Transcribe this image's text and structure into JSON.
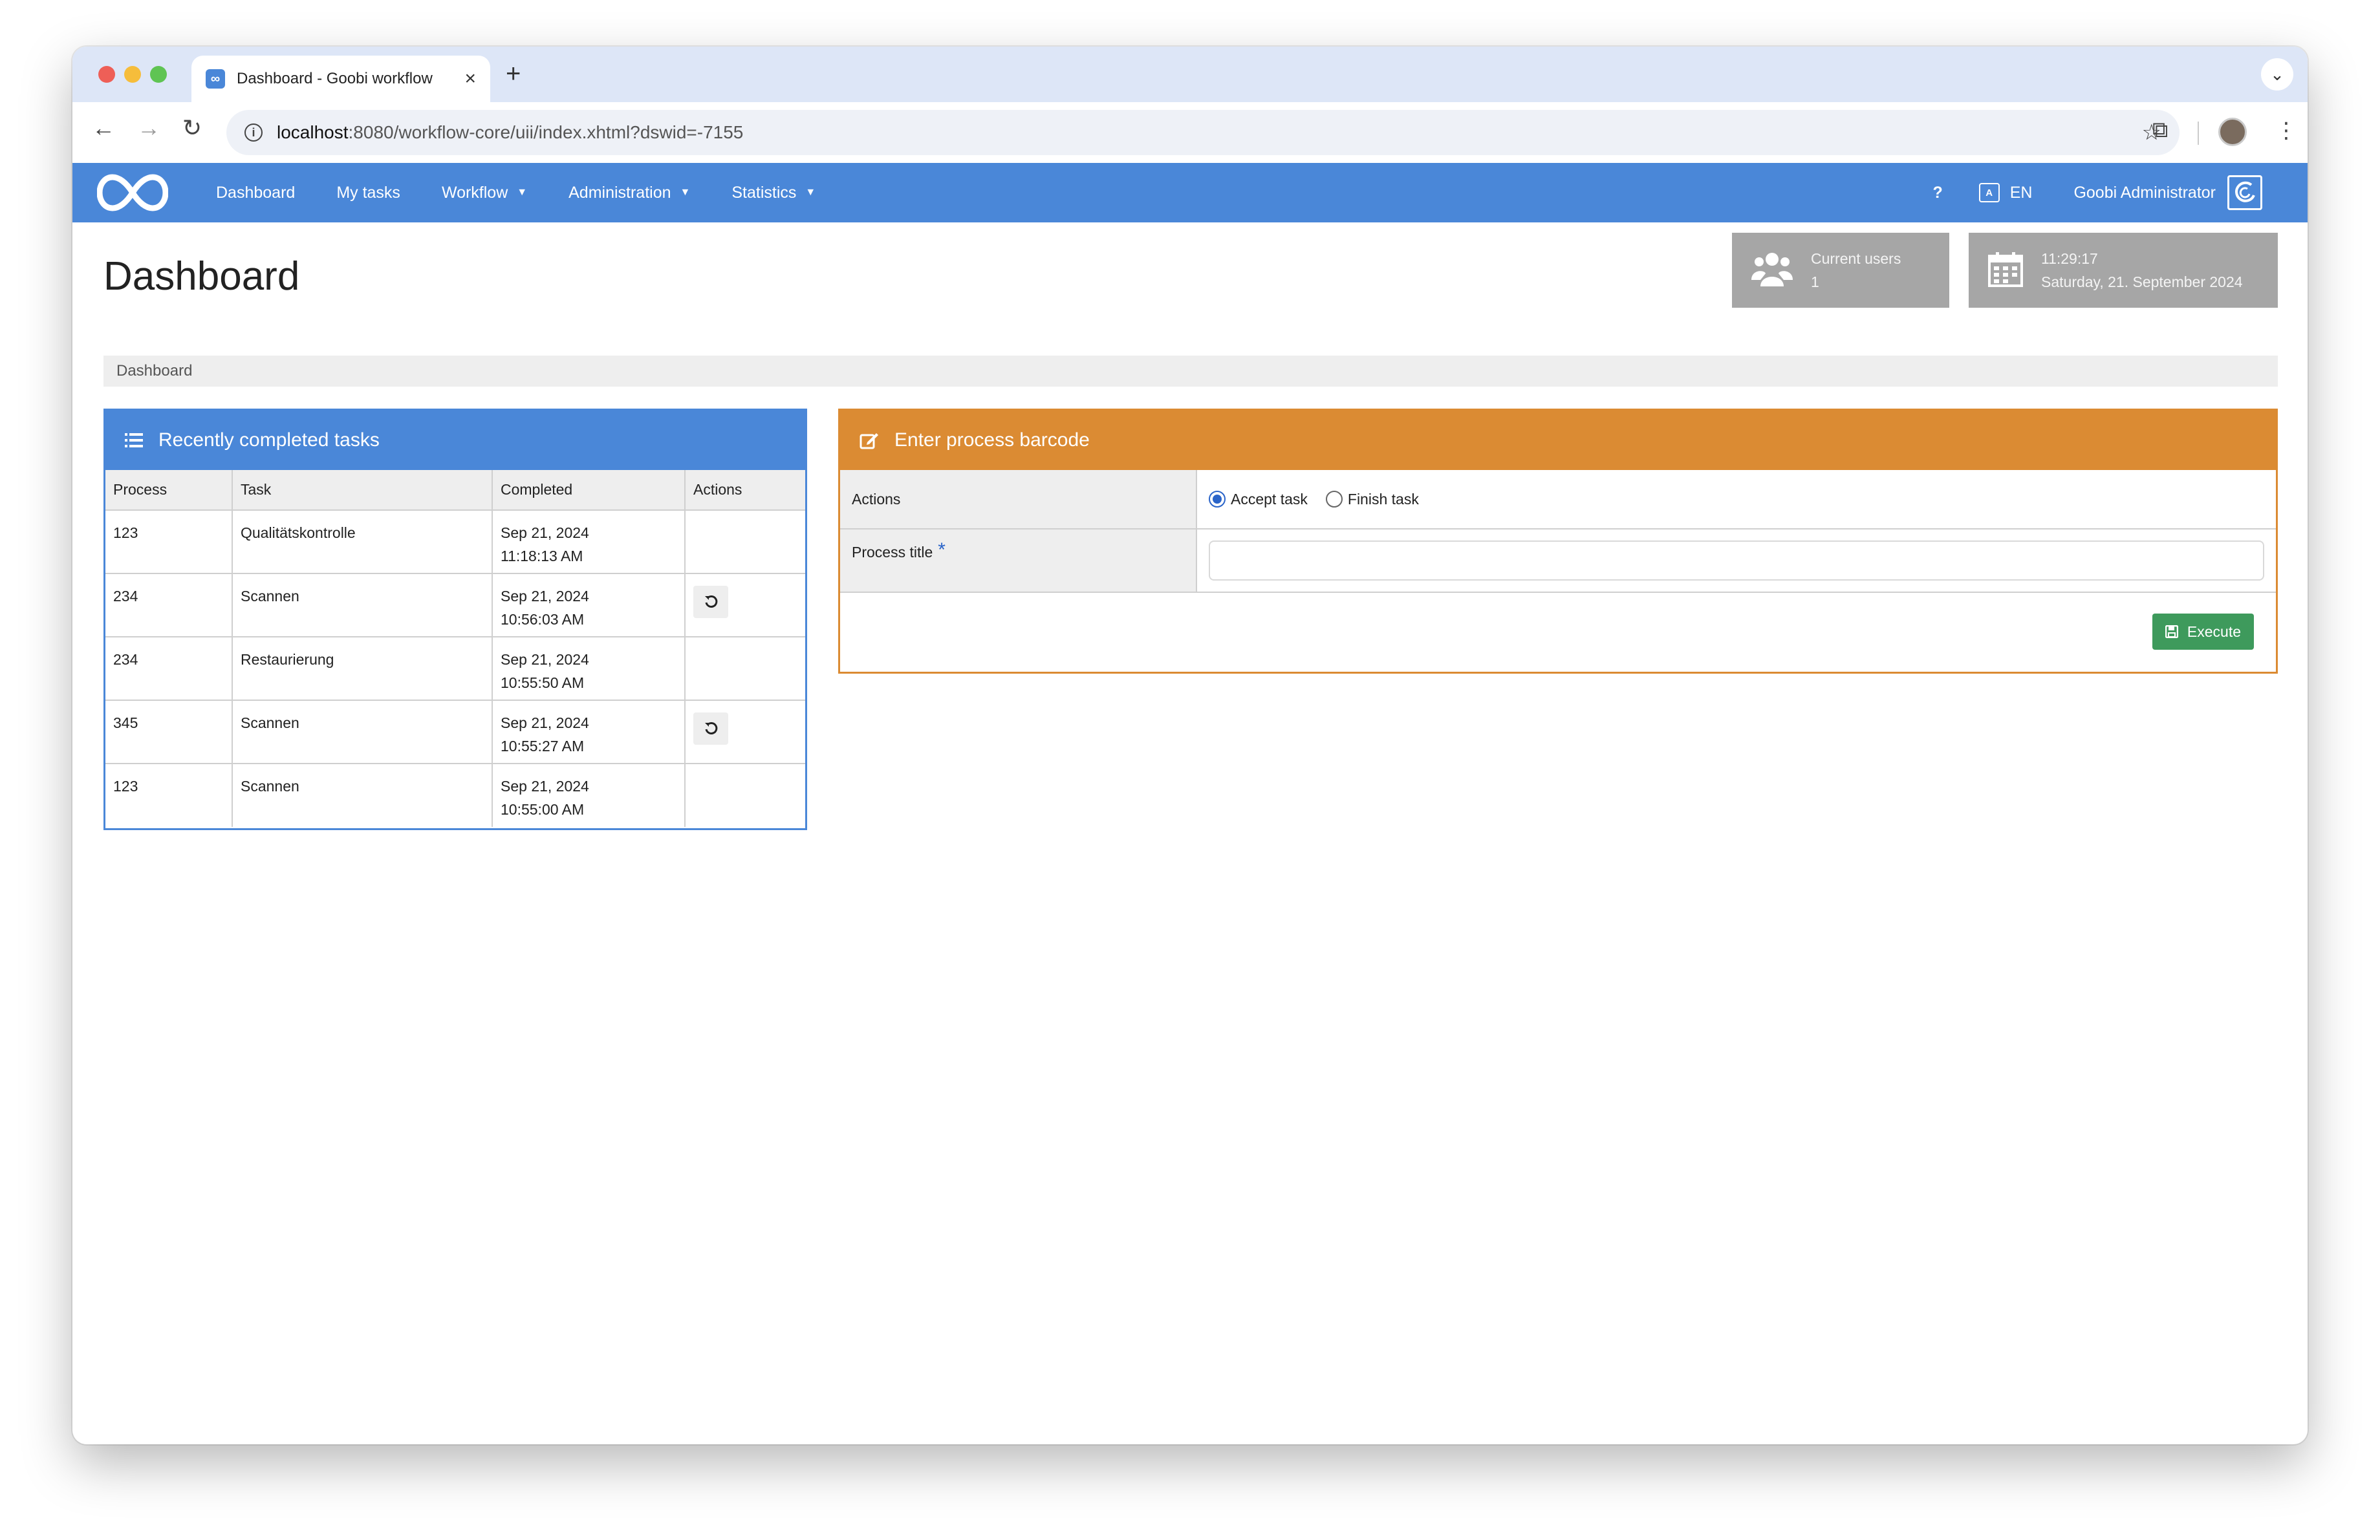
{
  "browser": {
    "tab_title": "Dashboard - Goobi workflow",
    "url_host": "localhost",
    "url_rest": ":8080/workflow-core/uii/index.xhtml?dswid=-7155"
  },
  "navbar": {
    "menu": [
      {
        "label": "Dashboard",
        "dropdown": false
      },
      {
        "label": "My tasks",
        "dropdown": false
      },
      {
        "label": "Workflow",
        "dropdown": true
      },
      {
        "label": "Administration",
        "dropdown": true
      },
      {
        "label": "Statistics",
        "dropdown": true
      }
    ],
    "help": "?",
    "language": "EN",
    "user": "Goobi Administrator"
  },
  "page": {
    "title": "Dashboard",
    "breadcrumb": "Dashboard"
  },
  "tiles": {
    "users_label": "Current users",
    "users_count": "1",
    "time": "11:29:17",
    "date": "Saturday, 21. September 2024"
  },
  "tasks_panel": {
    "title": "Recently completed tasks",
    "columns": [
      "Process",
      "Task",
      "Completed",
      "Actions"
    ],
    "rows": [
      {
        "process": "123",
        "task": "Qualitätskontrolle",
        "date": "Sep 21, 2024",
        "time": "11:18:13 AM",
        "reset": false
      },
      {
        "process": "234",
        "task": "Scannen",
        "date": "Sep 21, 2024",
        "time": "10:56:03 AM",
        "reset": true
      },
      {
        "process": "234",
        "task": "Restaurierung",
        "date": "Sep 21, 2024",
        "time": "10:55:50 AM",
        "reset": false
      },
      {
        "process": "345",
        "task": "Scannen",
        "date": "Sep 21, 2024",
        "time": "10:55:27 AM",
        "reset": true
      },
      {
        "process": "123",
        "task": "Scannen",
        "date": "Sep 21, 2024",
        "time": "10:55:00 AM",
        "reset": false
      }
    ]
  },
  "barcode_panel": {
    "title": "Enter process barcode",
    "actions_label": "Actions",
    "accept_label": "Accept task",
    "finish_label": "Finish task",
    "selected_action": "accept",
    "process_title_label": "Process title",
    "required_marker": "*",
    "process_title_value": "",
    "execute_label": "Execute"
  },
  "colors": {
    "primary": "#4a87d8",
    "orange": "#db8b33",
    "success": "#3e9a5c",
    "tile": "#a6a6a6"
  }
}
